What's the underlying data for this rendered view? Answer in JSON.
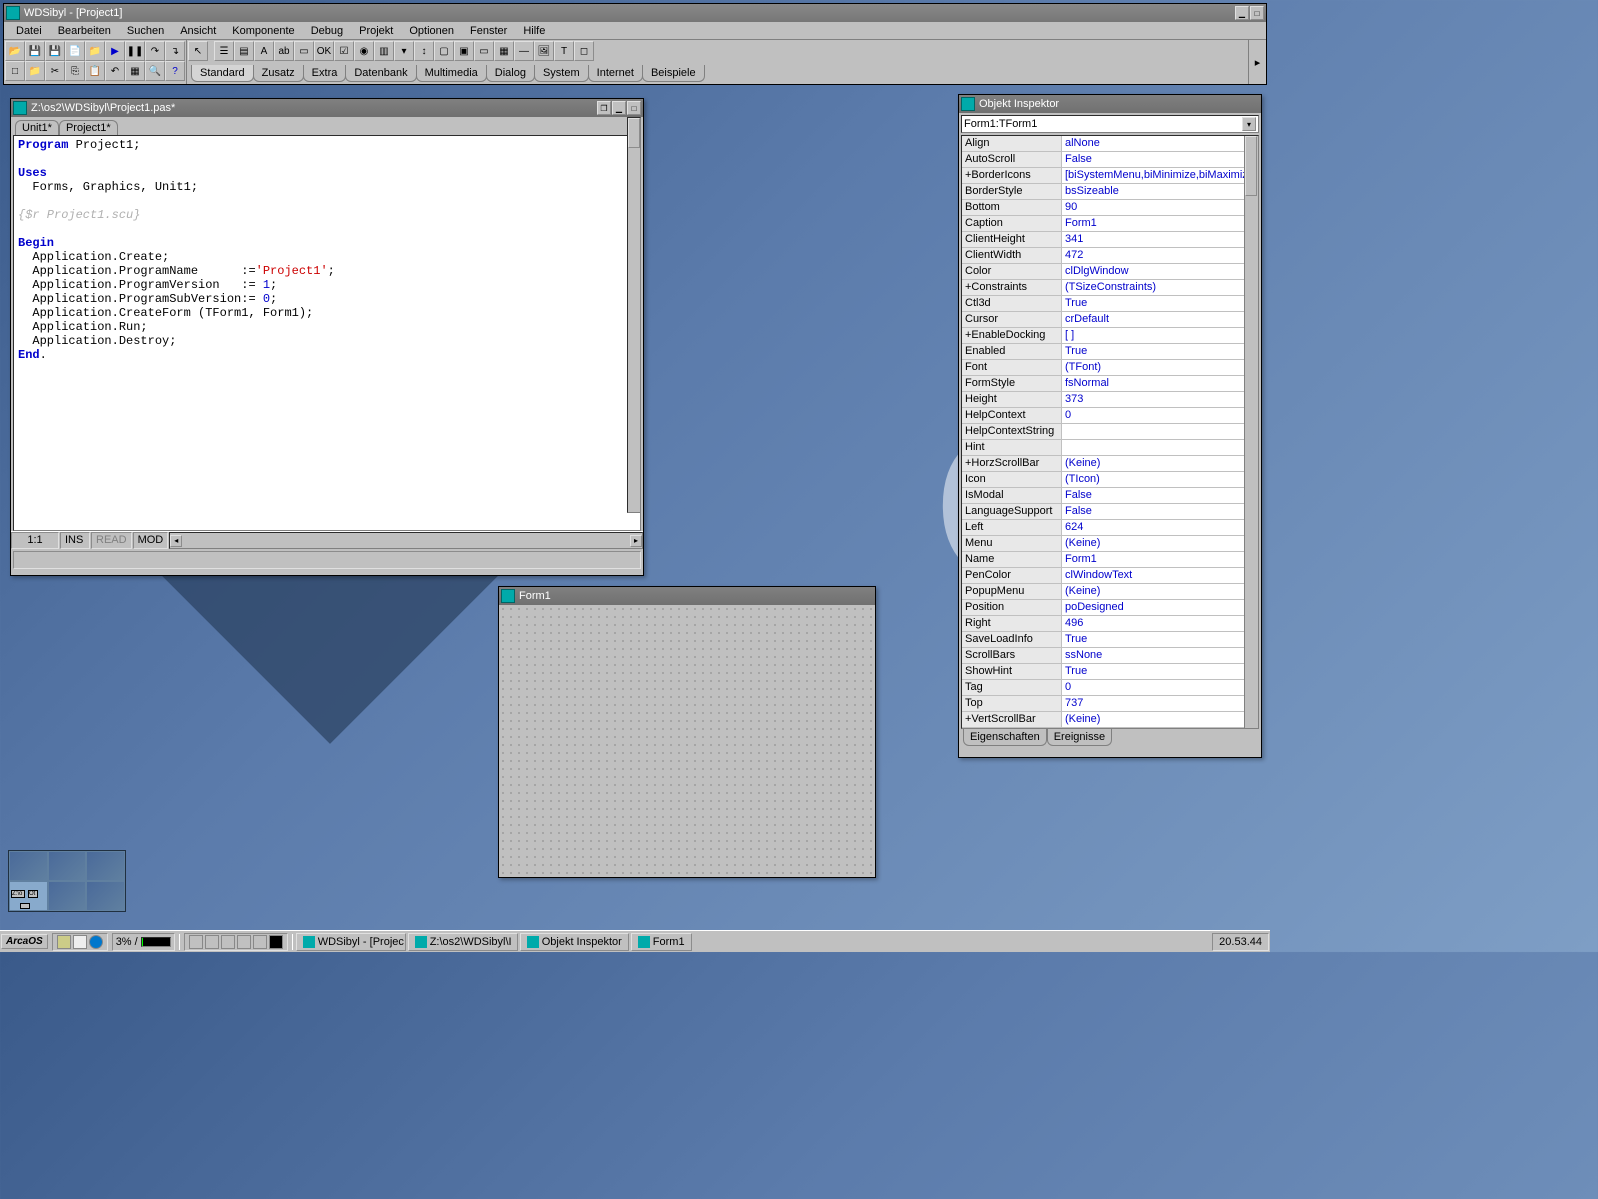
{
  "ide": {
    "title": "WDSibyl  -  [Project1]",
    "menu": [
      "Datei",
      "Bearbeiten",
      "Suchen",
      "Ansicht",
      "Komponente",
      "Debug",
      "Projekt",
      "Optionen",
      "Fenster",
      "Hilfe"
    ],
    "palette_tabs": [
      "Standard",
      "Zusatz",
      "Extra",
      "Datenbank",
      "Multimedia",
      "Dialog",
      "System",
      "Internet",
      "Beispiele"
    ]
  },
  "editor": {
    "title": "Z:\\os2\\WDSibyl\\Project1.pas*",
    "tabs": [
      "Unit1*",
      "Project1*"
    ],
    "status": {
      "pos": "1:1",
      "ins": "INS",
      "read": "READ",
      "mod": "MOD"
    }
  },
  "form": {
    "title": "Form1"
  },
  "inspector": {
    "title": "Objekt Inspektor",
    "combo": "Form1:TForm1",
    "tabs": [
      "Eigenschaften",
      "Ereignisse"
    ],
    "props": [
      {
        "n": "Align",
        "v": "alNone"
      },
      {
        "n": "AutoScroll",
        "v": "False"
      },
      {
        "n": "+BorderIcons",
        "v": "[biSystemMenu,biMinimize,biMaximize]"
      },
      {
        "n": "BorderStyle",
        "v": "bsSizeable"
      },
      {
        "n": "Bottom",
        "v": "90"
      },
      {
        "n": "Caption",
        "v": "Form1"
      },
      {
        "n": "ClientHeight",
        "v": "341"
      },
      {
        "n": "ClientWidth",
        "v": "472"
      },
      {
        "n": "Color",
        "v": "clDlgWindow"
      },
      {
        "n": "+Constraints",
        "v": "(TSizeConstraints)"
      },
      {
        "n": "Ctl3d",
        "v": "True"
      },
      {
        "n": "Cursor",
        "v": "crDefault"
      },
      {
        "n": "+EnableDocking",
        "v": "[ ]"
      },
      {
        "n": "Enabled",
        "v": "True"
      },
      {
        "n": "Font",
        "v": "(TFont)"
      },
      {
        "n": "FormStyle",
        "v": "fsNormal"
      },
      {
        "n": "Height",
        "v": "373"
      },
      {
        "n": "HelpContext",
        "v": "0"
      },
      {
        "n": "HelpContextString",
        "v": ""
      },
      {
        "n": "Hint",
        "v": ""
      },
      {
        "n": "+HorzScrollBar",
        "v": "(Keine)"
      },
      {
        "n": "Icon",
        "v": "(TIcon)"
      },
      {
        "n": "IsModal",
        "v": "False"
      },
      {
        "n": "LanguageSupport",
        "v": "False"
      },
      {
        "n": "Left",
        "v": "624"
      },
      {
        "n": "Menu",
        "v": "(Keine)"
      },
      {
        "n": "Name",
        "v": "Form1"
      },
      {
        "n": "PenColor",
        "v": "clWindowText"
      },
      {
        "n": "PopupMenu",
        "v": "(Keine)"
      },
      {
        "n": "Position",
        "v": "poDesigned"
      },
      {
        "n": "Right",
        "v": "496"
      },
      {
        "n": "SaveLoadInfo",
        "v": "True"
      },
      {
        "n": "ScrollBars",
        "v": "ssNone"
      },
      {
        "n": "ShowHint",
        "v": "True"
      },
      {
        "n": "Tag",
        "v": "0"
      },
      {
        "n": "Top",
        "v": "737"
      },
      {
        "n": "+VertScrollBar",
        "v": "(Keine)"
      }
    ]
  },
  "taskbar": {
    "start": "ArcaOS",
    "cpu": "3% /",
    "tasks": [
      "WDSibyl  -  [Projec",
      "Z:\\os2\\WDSibyl\\I",
      "Objekt Inspektor",
      "Form1"
    ],
    "clock": "20.53.44"
  }
}
